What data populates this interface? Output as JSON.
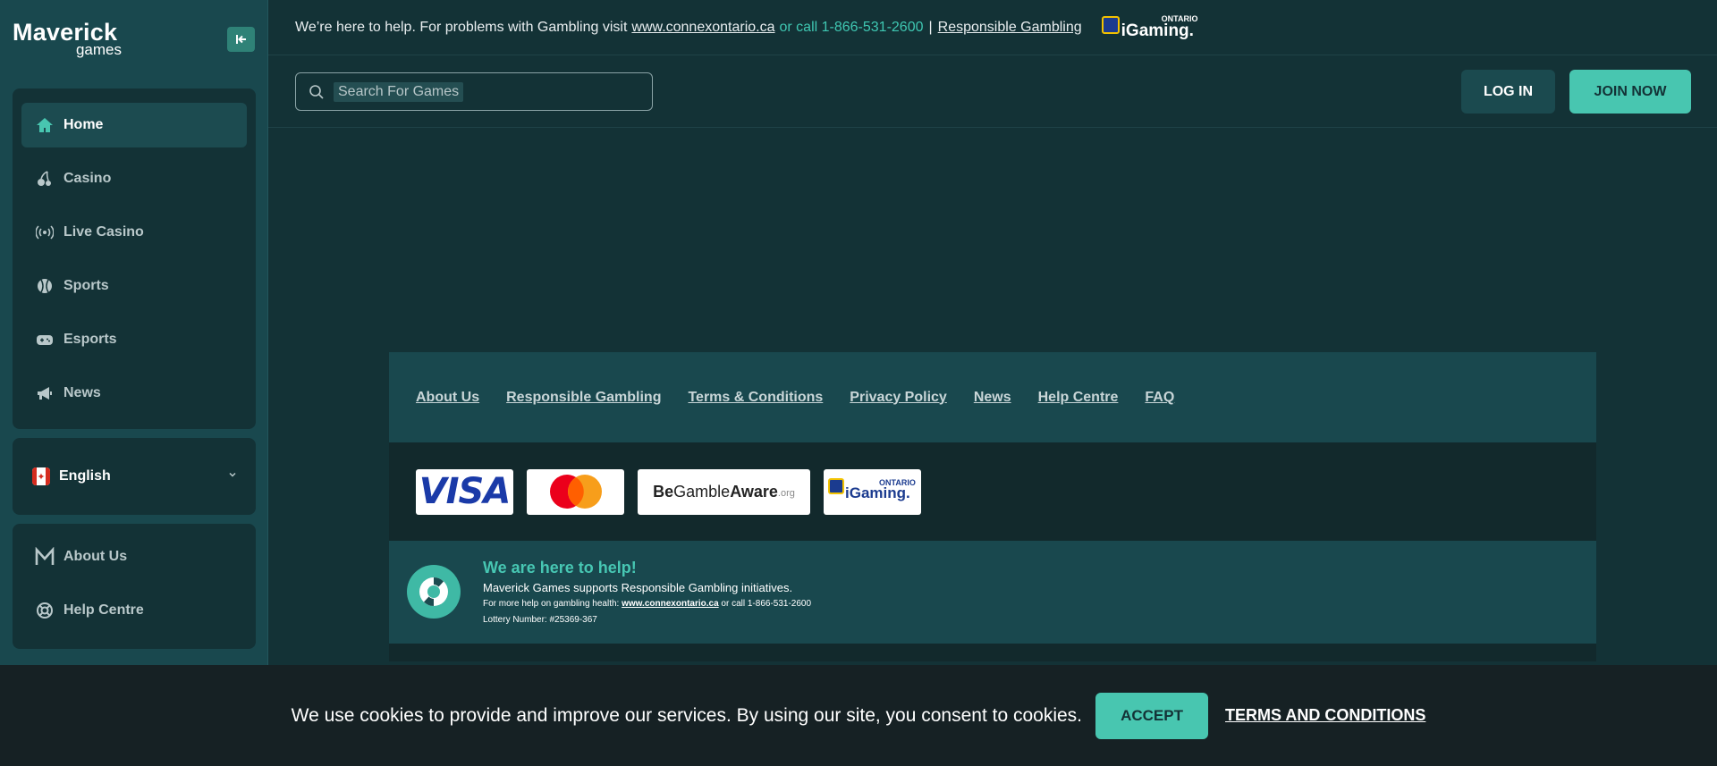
{
  "brand": {
    "name": "Maverick",
    "sub": "games"
  },
  "topbar": {
    "message": "We’re here to help. For problems with Gambling visit",
    "link": "www.connexontario.ca",
    "phone_text": "or call 1-866-531-2600",
    "separator": "|",
    "rg_link": "Responsible Gambling",
    "igaming_word": "iGaming.",
    "igaming_region": "ONTARIO"
  },
  "search": {
    "placeholder": "Search For Games"
  },
  "header": {
    "login": "LOG IN",
    "join": "JOIN NOW"
  },
  "sidebar": {
    "nav": [
      {
        "label": "Home",
        "icon": "home-icon",
        "active": true
      },
      {
        "label": "Casino",
        "icon": "cherry-icon"
      },
      {
        "label": "Live Casino",
        "icon": "broadcast-icon"
      },
      {
        "label": "Sports",
        "icon": "ball-icon"
      },
      {
        "label": "Esports",
        "icon": "gamepad-icon"
      },
      {
        "label": "News",
        "icon": "megaphone-icon"
      }
    ],
    "language": "English",
    "links": [
      {
        "label": "About Us",
        "icon": "maverick-m-icon"
      },
      {
        "label": "Help Centre",
        "icon": "lifebuoy-icon"
      }
    ]
  },
  "footer": {
    "links": [
      "About Us",
      "Responsible Gambling",
      "Terms & Conditions",
      "Privacy Policy",
      "News",
      "Help Centre",
      "FAQ"
    ],
    "payments": {
      "visa": "VISA",
      "bga_be": "Be",
      "bga_gamble": "Gamble",
      "bga_aware": "Aware",
      "bga_org": ".org",
      "igaming_word": "iGaming.",
      "igaming_region": "ONTARIO"
    },
    "help": {
      "title": "We are here to help!",
      "line1": "Maverick Games supports Responsible Gambling initiatives.",
      "line2_prefix": "For more help on gambling health:",
      "line2_link": "www.connexontario.ca",
      "line2_suffix": "or call 1-866-531-2600",
      "line3": "Lottery Number: #25369-367"
    }
  },
  "cookie": {
    "text": "We use cookies to provide and improve our services. By using our site, you consent to cookies.",
    "accept": "ACCEPT",
    "terms": "TERMS AND CONDITIONS"
  },
  "colors": {
    "accent": "#48c6b0",
    "background": "#133236",
    "sidebar": "#19484e"
  }
}
